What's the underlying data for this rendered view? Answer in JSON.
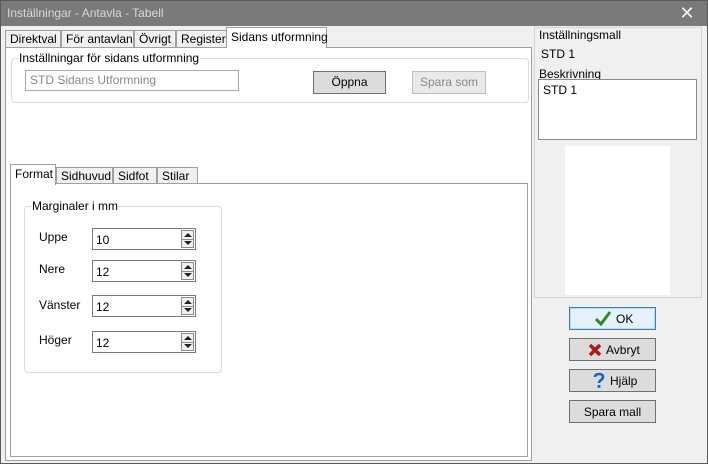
{
  "window": {
    "title": "Inställningar - Antavla - Tabell",
    "close_glyph": "✕"
  },
  "tabs": [
    {
      "label": "Direktval"
    },
    {
      "label": "För antavlan"
    },
    {
      "label": "Övrigt"
    },
    {
      "label": "Register"
    },
    {
      "label": "Sidans utformning",
      "active": true
    }
  ],
  "page_settings": {
    "group_title": "Inställningar för sidans utformning",
    "template_value": "STD Sidans Utformning",
    "open_button": "Öppna",
    "save_as_button": "Spara som"
  },
  "inner_tabs": [
    {
      "label": "Format",
      "active": true
    },
    {
      "label": "Sidhuvud"
    },
    {
      "label": "Sidfot"
    },
    {
      "label": "Stilar"
    }
  ],
  "margins": {
    "group_title": "Marginaler i mm",
    "fields": [
      {
        "label": "Uppe",
        "value": "10"
      },
      {
        "label": "Nere",
        "value": "12"
      },
      {
        "label": "Vänster",
        "value": "12"
      },
      {
        "label": "Höger",
        "value": "12"
      }
    ]
  },
  "right_panel": {
    "template_label": "Inställningsmall",
    "template_value": "STD 1",
    "description_label": "Beskrivning",
    "description_value": "STD 1"
  },
  "buttons": {
    "ok": "OK",
    "cancel": "Avbryt",
    "help": "Hjälp",
    "save_template": "Spara mall"
  },
  "colors": {
    "ok_check": "#2e8b1e",
    "cancel_x": "#b51616",
    "help_q": "#1f5fbf"
  }
}
